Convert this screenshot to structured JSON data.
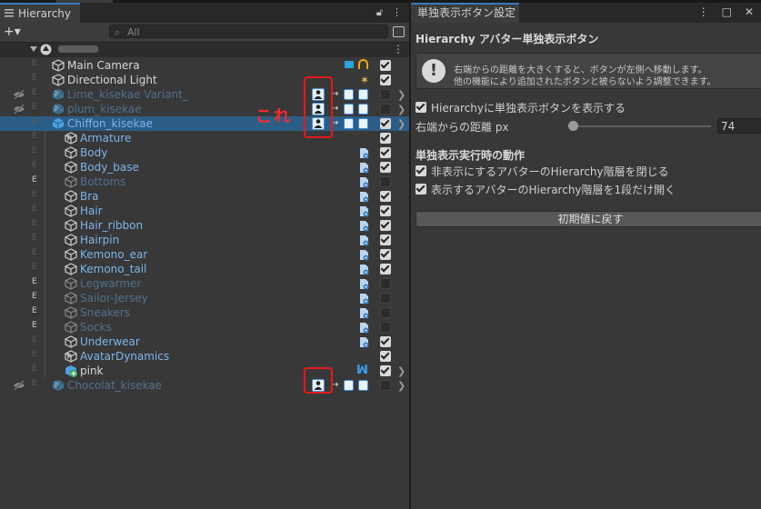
{
  "hierarchy": {
    "tab_title": "Hierarchy",
    "search_placeholder": "All",
    "add_label": "+▾",
    "rows": [
      {
        "name": "Main Camera",
        "color": "white",
        "e": "E",
        "e_on": false,
        "x": 74,
        "arrow": "",
        "icon": "cube",
        "check": "on",
        "extra": "camera",
        "right_arrow": false
      },
      {
        "name": "Directional Light",
        "color": "white",
        "e": "E",
        "e_on": false,
        "x": 74,
        "arrow": "",
        "icon": "cube",
        "check": "on",
        "extra": "light",
        "right_arrow": false
      },
      {
        "name": "Lime_kisekae Variant_",
        "color": "blueDim",
        "e": "E",
        "e_on": false,
        "x": 74,
        "arrow": "r",
        "icon": "prefab",
        "check": "off",
        "extra": "avatar",
        "right_arrow": true
      },
      {
        "name": "plum_kisekae",
        "color": "blueDim",
        "e": "E",
        "e_on": false,
        "x": 74,
        "arrow": "r",
        "icon": "prefab",
        "check": "off",
        "extra": "avatar",
        "right_arrow": true
      },
      {
        "name": "Chiffon_kisekae",
        "color": "blue",
        "e": "E",
        "e_on": false,
        "x": 74,
        "arrow": "d",
        "icon": "prefab",
        "check": "on",
        "extra": "avatar",
        "right_arrow": true,
        "selected": true
      },
      {
        "name": "Armature",
        "color": "blue",
        "e": "E",
        "e_on": false,
        "x": 88,
        "arrow": "r",
        "icon": "cube",
        "check": "on",
        "extra": "",
        "right_arrow": false
      },
      {
        "name": "Body",
        "color": "blue",
        "e": "E",
        "e_on": false,
        "x": 88,
        "arrow": "",
        "icon": "cube",
        "check": "on",
        "extra": "script",
        "right_arrow": false
      },
      {
        "name": "Body_base",
        "color": "blue",
        "e": "E",
        "e_on": false,
        "x": 88,
        "arrow": "",
        "icon": "cube",
        "check": "on",
        "extra": "script",
        "right_arrow": false
      },
      {
        "name": "Bottoms",
        "color": "blueDim",
        "e": "E",
        "e_on": true,
        "x": 88,
        "arrow": "",
        "icon": "cube",
        "check": "off",
        "extra": "script",
        "right_arrow": false
      },
      {
        "name": "Bra",
        "color": "blue",
        "e": "E",
        "e_on": false,
        "x": 88,
        "arrow": "",
        "icon": "cube",
        "check": "on",
        "extra": "script",
        "right_arrow": false
      },
      {
        "name": "Hair",
        "color": "blue",
        "e": "E",
        "e_on": false,
        "x": 88,
        "arrow": "",
        "icon": "cube",
        "check": "on",
        "extra": "script",
        "right_arrow": false
      },
      {
        "name": "Hair_ribbon",
        "color": "blue",
        "e": "E",
        "e_on": false,
        "x": 88,
        "arrow": "",
        "icon": "cube",
        "check": "on",
        "extra": "script",
        "right_arrow": false
      },
      {
        "name": "Hairpin",
        "color": "blue",
        "e": "E",
        "e_on": false,
        "x": 88,
        "arrow": "",
        "icon": "cube",
        "check": "on",
        "extra": "script",
        "right_arrow": false
      },
      {
        "name": "Kemono_ear",
        "color": "blue",
        "e": "E",
        "e_on": false,
        "x": 88,
        "arrow": "",
        "icon": "cube",
        "check": "on",
        "extra": "script",
        "right_arrow": false
      },
      {
        "name": "Kemono_tail",
        "color": "blue",
        "e": "E",
        "e_on": false,
        "x": 88,
        "arrow": "",
        "icon": "cube",
        "check": "on",
        "extra": "script",
        "right_arrow": false
      },
      {
        "name": "Legwarmer",
        "color": "blueDim",
        "e": "E",
        "e_on": true,
        "x": 88,
        "arrow": "",
        "icon": "cube",
        "check": "off",
        "extra": "script",
        "right_arrow": false
      },
      {
        "name": "Sailor-Jersey",
        "color": "blueDim",
        "e": "E",
        "e_on": true,
        "x": 88,
        "arrow": "",
        "icon": "cube",
        "check": "off",
        "extra": "script",
        "right_arrow": false
      },
      {
        "name": "Sneakers",
        "color": "blueDim",
        "e": "E",
        "e_on": true,
        "x": 88,
        "arrow": "",
        "icon": "cube",
        "check": "off",
        "extra": "script",
        "right_arrow": false
      },
      {
        "name": "Socks",
        "color": "blueDim",
        "e": "E",
        "e_on": true,
        "x": 88,
        "arrow": "",
        "icon": "cube",
        "check": "off",
        "extra": "script",
        "right_arrow": false
      },
      {
        "name": "Underwear",
        "color": "blue",
        "e": "E",
        "e_on": false,
        "x": 88,
        "arrow": "",
        "icon": "cube",
        "check": "on",
        "extra": "script",
        "right_arrow": false
      },
      {
        "name": "AvatarDynamics",
        "color": "blue",
        "e": "E",
        "e_on": false,
        "x": 88,
        "arrow": "r",
        "icon": "cube",
        "check": "on",
        "extra": "",
        "right_arrow": false
      },
      {
        "name": "pink",
        "color": "white",
        "e": "E",
        "e_on": false,
        "x": 88,
        "arrow": "r",
        "icon": "prefabAdd",
        "check": "on",
        "extra": "mp",
        "right_arrow": true
      },
      {
        "name": "Chocolat_kisekae",
        "color": "blueDim",
        "e": "E",
        "e_on": false,
        "x": 74,
        "arrow": "r",
        "icon": "prefab",
        "check": "off",
        "extra": "avatar",
        "right_arrow": true
      }
    ],
    "annotation": "これ"
  },
  "settings": {
    "tab_title": "単独表示ボタン設定",
    "title": "Hierarchy アバター単独表示ボタン",
    "help_line1": "右端からの距離を大きくすると、ボタンが左側へ移動します。",
    "help_line2": "他の機能により追加されたボタンと被らないよう調整できます。",
    "show_button_label": "Hierarchyに単独表示ボタンを表示する",
    "distance_label": "右端からの距離 px",
    "distance_value": "74",
    "distance_fraction": 0.04,
    "behavior_title": "単独表示実行時の動作",
    "collapse_label": "非表示にするアバターのHierarchy階層を閉じる",
    "expand_label": "表示するアバターのHierarchy階層を1段だけ開く",
    "reset_label": "初期値に戻す"
  }
}
